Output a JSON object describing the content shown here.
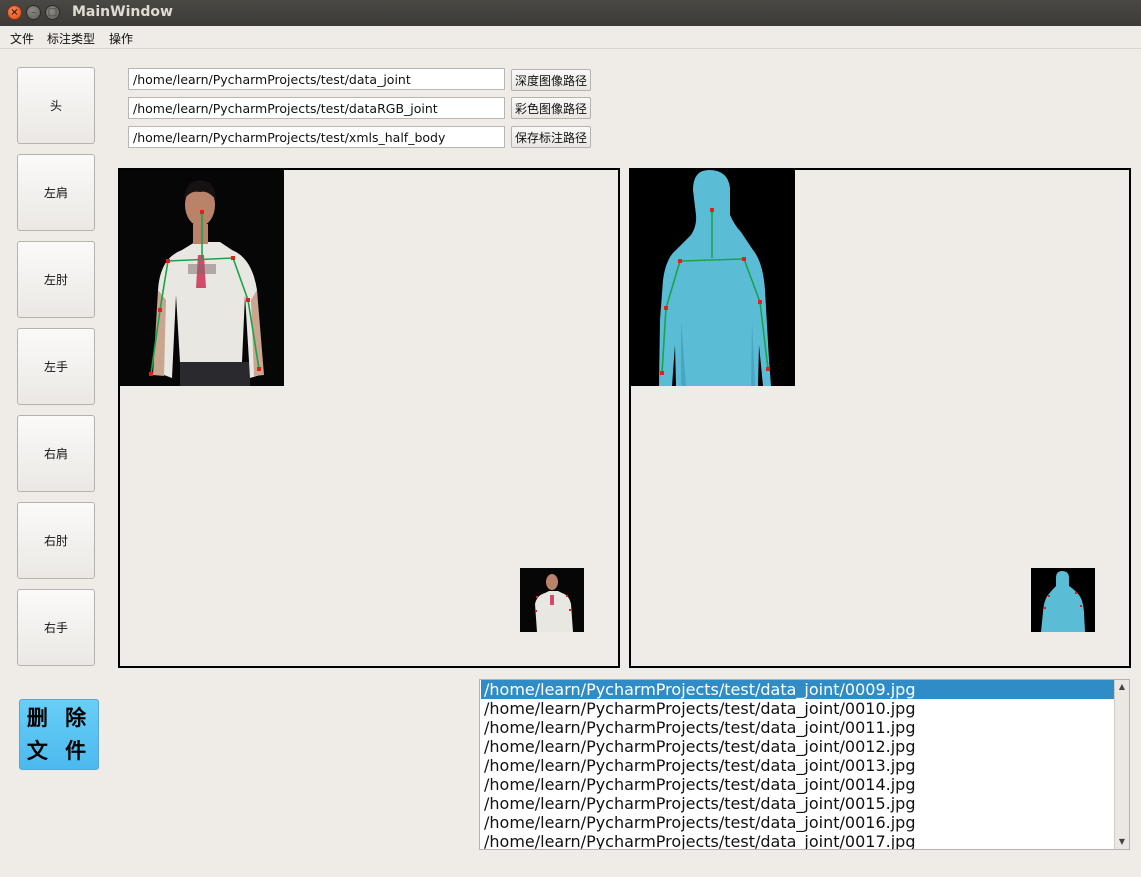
{
  "window": {
    "title": "MainWindow"
  },
  "menu": [
    "文件",
    "标注类型",
    "操作"
  ],
  "joint_buttons": [
    "头",
    "左肩",
    "左肘",
    "左手",
    "右肩",
    "右肘",
    "右手"
  ],
  "delete_button": {
    "label": "删 除\n文 件"
  },
  "paths": [
    {
      "value": "/home/learn/PycharmProjects/test/data_joint",
      "button": "深度图像路径"
    },
    {
      "value": "/home/learn/PycharmProjects/test/dataRGB_joint",
      "button": "彩色图像路径"
    },
    {
      "value": "/home/learn/PycharmProjects/test/xmls_half_body",
      "button": "保存标注路径"
    }
  ],
  "file_list": {
    "selected_index": 0,
    "items": [
      "/home/learn/PycharmProjects/test/data_joint/0009.jpg",
      "/home/learn/PycharmProjects/test/data_joint/0010.jpg",
      "/home/learn/PycharmProjects/test/data_joint/0011.jpg",
      "/home/learn/PycharmProjects/test/data_joint/0012.jpg",
      "/home/learn/PycharmProjects/test/data_joint/0013.jpg",
      "/home/learn/PycharmProjects/test/data_joint/0014.jpg",
      "/home/learn/PycharmProjects/test/data_joint/0015.jpg",
      "/home/learn/PycharmProjects/test/data_joint/0016.jpg",
      "/home/learn/PycharmProjects/test/data_joint/0017.jpg"
    ]
  },
  "colors": {
    "selection": "#308cc6",
    "skeleton_line": "#1aa34a",
    "joint_point": "#e0201a",
    "depth_body": "#5bbcd6",
    "delete_button": "#4cb9ef"
  },
  "icons": [
    "close-icon",
    "minimize-icon",
    "maximize-icon",
    "scroll-up-arrow-icon",
    "scroll-down-arrow-icon"
  ]
}
